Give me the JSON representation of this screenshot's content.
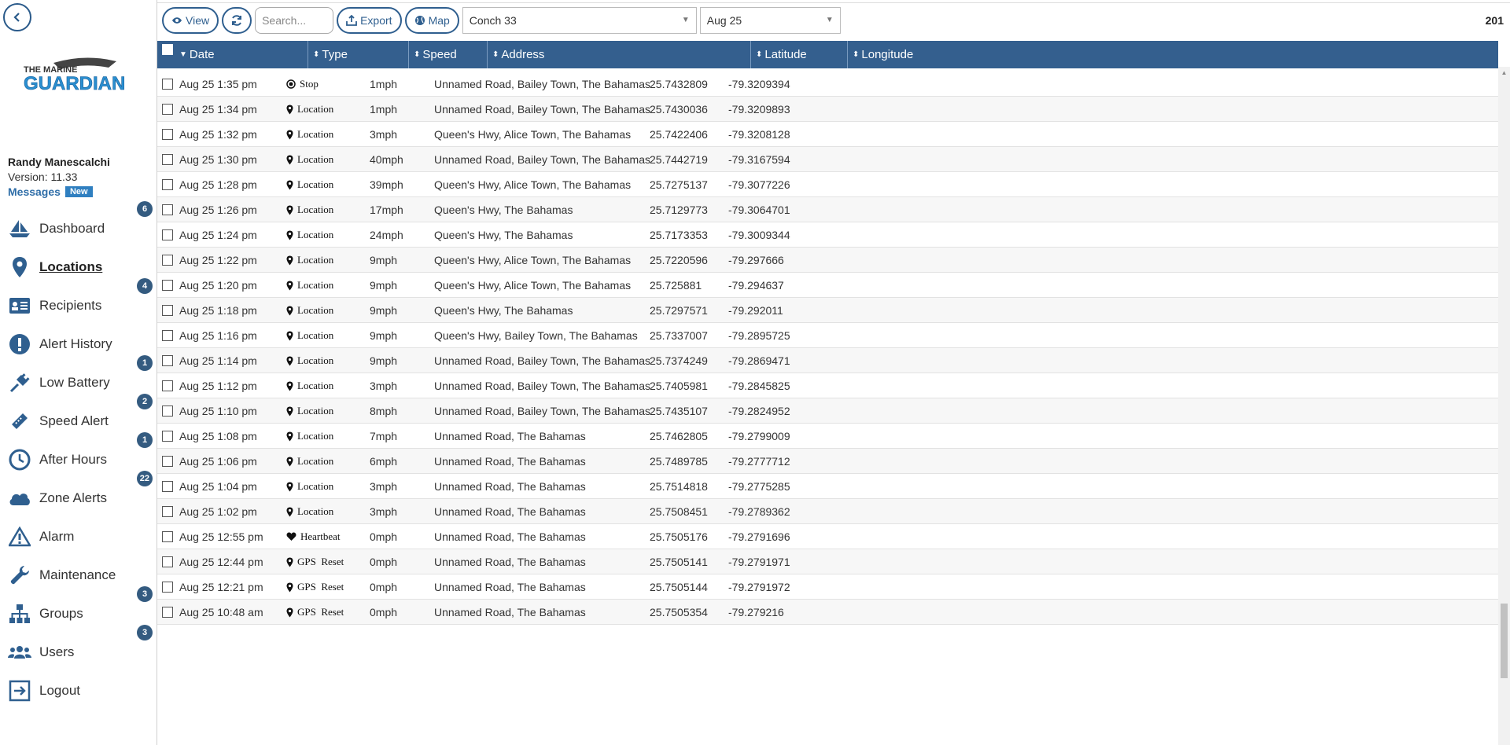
{
  "sidebar": {
    "logo_text_top": "THE MARINE",
    "logo_text_bottom": "GUARDIAN",
    "user_name": "Randy Manescalchi",
    "version": "Version: 11.33",
    "messages_label": "Messages",
    "messages_badge": "New",
    "nav": [
      {
        "label": "Dashboard",
        "icon": "sailboat-icon",
        "badge": "6"
      },
      {
        "label": "Locations",
        "icon": "map-pin-icon",
        "badge": "",
        "active": true
      },
      {
        "label": "Recipients",
        "icon": "id-card-icon",
        "badge": "4"
      },
      {
        "label": "Alert History",
        "icon": "exclamation-circle-icon",
        "badge": ""
      },
      {
        "label": "Low Battery",
        "icon": "plug-icon",
        "badge": "1"
      },
      {
        "label": "Speed Alert",
        "icon": "ticket-icon",
        "badge": "2"
      },
      {
        "label": "After Hours",
        "icon": "clock-icon",
        "badge": "1"
      },
      {
        "label": "Zone Alerts",
        "icon": "cloud-icon",
        "badge": "22"
      },
      {
        "label": "Alarm",
        "icon": "warning-triangle-icon",
        "badge": ""
      },
      {
        "label": "Maintenance",
        "icon": "wrench-icon",
        "badge": ""
      },
      {
        "label": "Groups",
        "icon": "sitemap-icon",
        "badge": "3"
      },
      {
        "label": "Users",
        "icon": "users-icon",
        "badge": "3"
      },
      {
        "label": "Logout",
        "icon": "logout-icon",
        "badge": ""
      }
    ]
  },
  "toolbar": {
    "view_label": "View",
    "search_placeholder": "Search...",
    "export_label": "Export",
    "map_label": "Map",
    "vessel_select": "Conch 33",
    "date_select": "Aug 25",
    "count": "201"
  },
  "table": {
    "headers": {
      "date": "Date",
      "type": "Type",
      "speed": "Speed",
      "address": "Address",
      "latitude": "Latitude",
      "longitude": "Longitude"
    },
    "rows": [
      {
        "date": "Aug 25 1:35 pm",
        "type": "Stop",
        "type_icon": "stop-circle-icon",
        "speed": "1mph",
        "address": "Unnamed Road, Bailey Town, The Bahamas",
        "lat": "25.7432809",
        "lon": "-79.3209394"
      },
      {
        "date": "Aug 25 1:34 pm",
        "type": "Location",
        "type_icon": "map-marker-icon",
        "speed": "1mph",
        "address": "Unnamed Road, Bailey Town, The Bahamas",
        "lat": "25.7430036",
        "lon": "-79.3209893"
      },
      {
        "date": "Aug 25 1:32 pm",
        "type": "Location",
        "type_icon": "map-marker-icon",
        "speed": "3mph",
        "address": "Queen's Hwy, Alice Town, The Bahamas",
        "lat": "25.7422406",
        "lon": "-79.3208128"
      },
      {
        "date": "Aug 25 1:30 pm",
        "type": "Location",
        "type_icon": "map-marker-icon",
        "speed": "40mph",
        "address": "Unnamed Road, Bailey Town, The Bahamas",
        "lat": "25.7442719",
        "lon": "-79.3167594"
      },
      {
        "date": "Aug 25 1:28 pm",
        "type": "Location",
        "type_icon": "map-marker-icon",
        "speed": "39mph",
        "address": "Queen's Hwy, Alice Town, The Bahamas",
        "lat": "25.7275137",
        "lon": "-79.3077226"
      },
      {
        "date": "Aug 25 1:26 pm",
        "type": "Location",
        "type_icon": "map-marker-icon",
        "speed": "17mph",
        "address": "Queen's Hwy, The Bahamas",
        "lat": "25.7129773",
        "lon": "-79.3064701"
      },
      {
        "date": "Aug 25 1:24 pm",
        "type": "Location",
        "type_icon": "map-marker-icon",
        "speed": "24mph",
        "address": "Queen's Hwy, The Bahamas",
        "lat": "25.7173353",
        "lon": "-79.3009344"
      },
      {
        "date": "Aug 25 1:22 pm",
        "type": "Location",
        "type_icon": "map-marker-icon",
        "speed": "9mph",
        "address": "Queen's Hwy, Alice Town, The Bahamas",
        "lat": "25.7220596",
        "lon": "-79.297666"
      },
      {
        "date": "Aug 25 1:20 pm",
        "type": "Location",
        "type_icon": "map-marker-icon",
        "speed": "9mph",
        "address": "Queen's Hwy, Alice Town, The Bahamas",
        "lat": "25.725881",
        "lon": "-79.294637"
      },
      {
        "date": "Aug 25 1:18 pm",
        "type": "Location",
        "type_icon": "map-marker-icon",
        "speed": "9mph",
        "address": "Queen's Hwy, The Bahamas",
        "lat": "25.7297571",
        "lon": "-79.292011"
      },
      {
        "date": "Aug 25 1:16 pm",
        "type": "Location",
        "type_icon": "map-marker-icon",
        "speed": "9mph",
        "address": "Queen's Hwy, Bailey Town, The Bahamas",
        "lat": "25.7337007",
        "lon": "-79.2895725"
      },
      {
        "date": "Aug 25 1:14 pm",
        "type": "Location",
        "type_icon": "map-marker-icon",
        "speed": "9mph",
        "address": "Unnamed Road, Bailey Town, The Bahamas",
        "lat": "25.7374249",
        "lon": "-79.2869471"
      },
      {
        "date": "Aug 25 1:12 pm",
        "type": "Location",
        "type_icon": "map-marker-icon",
        "speed": "3mph",
        "address": "Unnamed Road, Bailey Town, The Bahamas",
        "lat": "25.7405981",
        "lon": "-79.2845825"
      },
      {
        "date": "Aug 25 1:10 pm",
        "type": "Location",
        "type_icon": "map-marker-icon",
        "speed": "8mph",
        "address": "Unnamed Road, Bailey Town, The Bahamas",
        "lat": "25.7435107",
        "lon": "-79.2824952"
      },
      {
        "date": "Aug 25 1:08 pm",
        "type": "Location",
        "type_icon": "map-marker-icon",
        "speed": "7mph",
        "address": "Unnamed Road, The Bahamas",
        "lat": "25.7462805",
        "lon": "-79.2799009"
      },
      {
        "date": "Aug 25 1:06 pm",
        "type": "Location",
        "type_icon": "map-marker-icon",
        "speed": "6mph",
        "address": "Unnamed Road, The Bahamas",
        "lat": "25.7489785",
        "lon": "-79.2777712"
      },
      {
        "date": "Aug 25 1:04 pm",
        "type": "Location",
        "type_icon": "map-marker-icon",
        "speed": "3mph",
        "address": "Unnamed Road, The Bahamas",
        "lat": "25.7514818",
        "lon": "-79.2775285"
      },
      {
        "date": "Aug 25 1:02 pm",
        "type": "Location",
        "type_icon": "map-marker-icon",
        "speed": "3mph",
        "address": "Unnamed Road, The Bahamas",
        "lat": "25.7508451",
        "lon": "-79.2789362"
      },
      {
        "date": "Aug 25 12:55 pm",
        "type": "Heartbeat",
        "type_icon": "heart-icon",
        "speed": "0mph",
        "address": "Unnamed Road, The Bahamas",
        "lat": "25.7505176",
        "lon": "-79.2791696"
      },
      {
        "date": "Aug 25 12:44 pm",
        "type": "GPS  Reset",
        "type_icon": "map-marker-icon",
        "speed": "0mph",
        "address": "Unnamed Road, The Bahamas",
        "lat": "25.7505141",
        "lon": "-79.2791971"
      },
      {
        "date": "Aug 25 12:21 pm",
        "type": "GPS  Reset",
        "type_icon": "map-marker-icon",
        "speed": "0mph",
        "address": "Unnamed Road, The Bahamas",
        "lat": "25.7505144",
        "lon": "-79.2791972"
      },
      {
        "date": "Aug 25 10:48 am",
        "type": "GPS  Reset",
        "type_icon": "map-marker-icon",
        "speed": "0mph",
        "address": "Unnamed Road, The Bahamas",
        "lat": "25.7505354",
        "lon": "-79.279216"
      }
    ]
  },
  "colors": {
    "header_bg": "#345f8e",
    "accent": "#2f5f8f",
    "badge": "#345b80",
    "logo_blue": "#2a8fd0"
  }
}
